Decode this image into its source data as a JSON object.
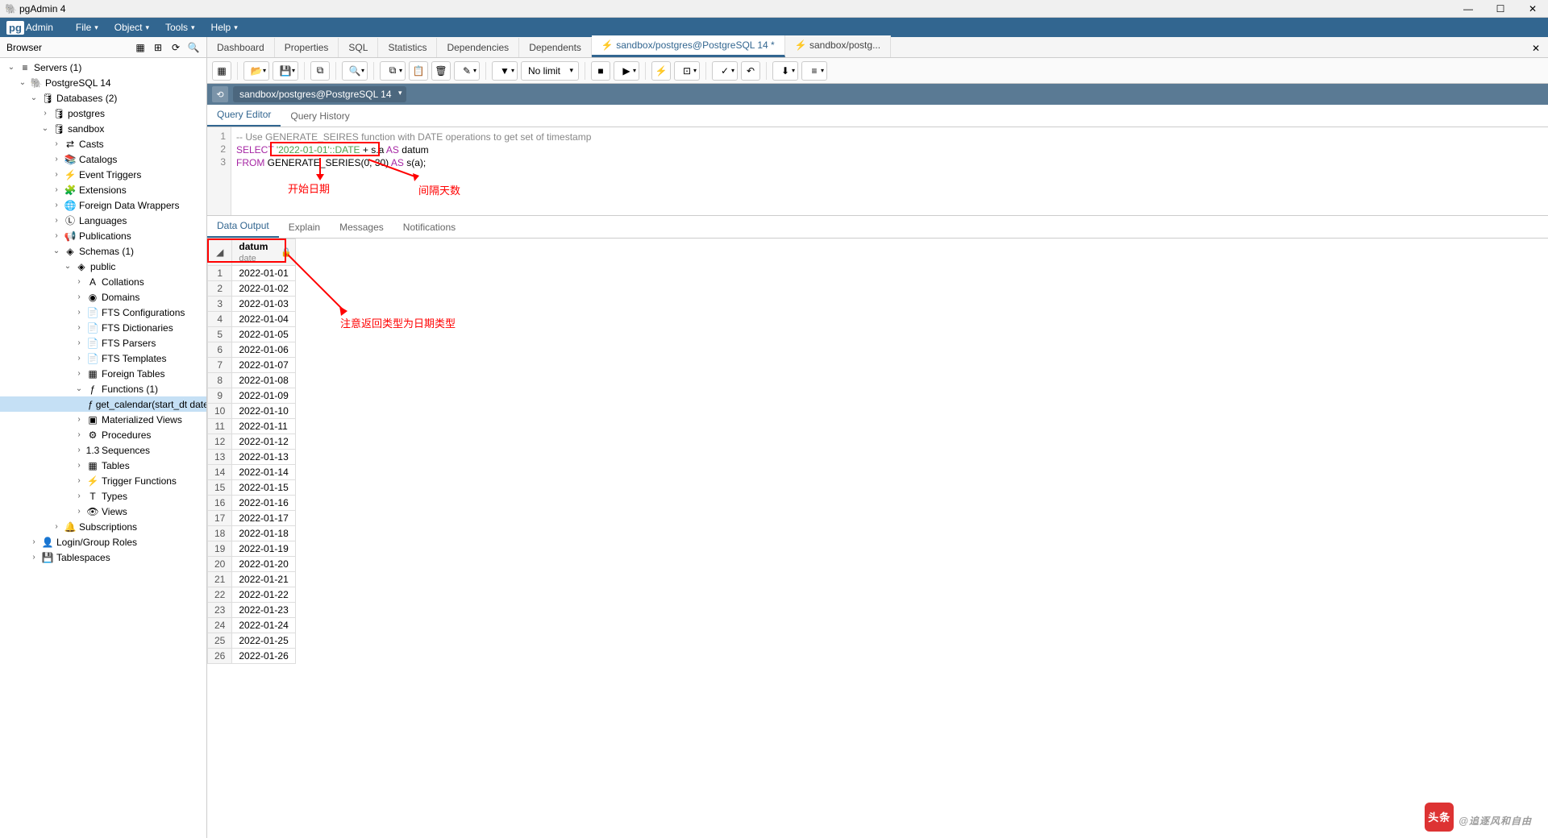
{
  "window": {
    "title": "pgAdmin 4"
  },
  "menubar": {
    "logo": "Admin",
    "items": [
      "File",
      "Object",
      "Tools",
      "Help"
    ]
  },
  "sidebar": {
    "title": "Browser",
    "tree": [
      {
        "i": 0,
        "t": "v",
        "ic": "srv",
        "l": "Servers (1)"
      },
      {
        "i": 1,
        "t": "v",
        "ic": "pg",
        "l": "PostgreSQL 14"
      },
      {
        "i": 2,
        "t": "v",
        "ic": "db",
        "l": "Databases (2)"
      },
      {
        "i": 3,
        "t": ">",
        "ic": "db1",
        "l": "postgres"
      },
      {
        "i": 3,
        "t": "v",
        "ic": "db1",
        "l": "sandbox"
      },
      {
        "i": 4,
        "t": ">",
        "ic": "cast",
        "l": "Casts"
      },
      {
        "i": 4,
        "t": ">",
        "ic": "cat",
        "l": "Catalogs"
      },
      {
        "i": 4,
        "t": ">",
        "ic": "evt",
        "l": "Event Triggers"
      },
      {
        "i": 4,
        "t": ">",
        "ic": "ext",
        "l": "Extensions"
      },
      {
        "i": 4,
        "t": ">",
        "ic": "fdw",
        "l": "Foreign Data Wrappers"
      },
      {
        "i": 4,
        "t": ">",
        "ic": "lang",
        "l": "Languages"
      },
      {
        "i": 4,
        "t": ">",
        "ic": "pub",
        "l": "Publications"
      },
      {
        "i": 4,
        "t": "v",
        "ic": "sch",
        "l": "Schemas (1)"
      },
      {
        "i": 5,
        "t": "v",
        "ic": "pub2",
        "l": "public"
      },
      {
        "i": 6,
        "t": ">",
        "ic": "coll",
        "l": "Collations"
      },
      {
        "i": 6,
        "t": ">",
        "ic": "dom",
        "l": "Domains"
      },
      {
        "i": 6,
        "t": ">",
        "ic": "fts",
        "l": "FTS Configurations"
      },
      {
        "i": 6,
        "t": ">",
        "ic": "fts",
        "l": "FTS Dictionaries"
      },
      {
        "i": 6,
        "t": ">",
        "ic": "fts",
        "l": "FTS Parsers"
      },
      {
        "i": 6,
        "t": ">",
        "ic": "fts",
        "l": "FTS Templates"
      },
      {
        "i": 6,
        "t": ">",
        "ic": "ft",
        "l": "Foreign Tables"
      },
      {
        "i": 6,
        "t": "v",
        "ic": "fn",
        "l": "Functions (1)"
      },
      {
        "i": 7,
        "t": "",
        "ic": "fn1",
        "l": "get_calendar(start_dt date, d...",
        "sel": true
      },
      {
        "i": 6,
        "t": ">",
        "ic": "mv",
        "l": "Materialized Views"
      },
      {
        "i": 6,
        "t": ">",
        "ic": "proc",
        "l": "Procedures"
      },
      {
        "i": 6,
        "t": ">",
        "ic": "seq",
        "l": "Sequences"
      },
      {
        "i": 6,
        "t": ">",
        "ic": "tbl",
        "l": "Tables"
      },
      {
        "i": 6,
        "t": ">",
        "ic": "trg",
        "l": "Trigger Functions"
      },
      {
        "i": 6,
        "t": ">",
        "ic": "typ",
        "l": "Types"
      },
      {
        "i": 6,
        "t": ">",
        "ic": "vw",
        "l": "Views"
      },
      {
        "i": 4,
        "t": ">",
        "ic": "sub",
        "l": "Subscriptions"
      },
      {
        "i": 2,
        "t": ">",
        "ic": "role",
        "l": "Login/Group Roles"
      },
      {
        "i": 2,
        "t": ">",
        "ic": "ts",
        "l": "Tablespaces"
      }
    ]
  },
  "tabs": {
    "items": [
      "Dashboard",
      "Properties",
      "SQL",
      "Statistics",
      "Dependencies",
      "Dependents"
    ],
    "special": [
      {
        "label": "sandbox/postgres@PostgreSQL 14 *",
        "icon": "⚡",
        "active": true
      },
      {
        "label": "sandbox/postg...",
        "icon": "⚡",
        "active": false
      }
    ]
  },
  "toolbar": {
    "nolimit": "No limit"
  },
  "connection": {
    "text": "sandbox/postgres@PostgreSQL 14"
  },
  "editor_tabs": [
    "Query Editor",
    "Query History"
  ],
  "sql": {
    "l1": "-- Use GENERATE_SEIRES function with DATE operations to get set of timestamp",
    "l2_select": "SELECT",
    "l2_str": "'2022-01-01'::DATE",
    "l2_rest1": " + s.a ",
    "l2_as": "AS",
    "l2_rest2": " datum",
    "l3_from": "FROM",
    "l3_fn": " GENERATE_SERIES",
    "l3_args": "(0, 30) ",
    "l3_as": "AS",
    "l3_rest": " s(a);"
  },
  "annotations": {
    "a1": "开始日期",
    "a2": "间隔天数",
    "a3": "注意返回类型为日期类型"
  },
  "result_tabs": [
    "Data Output",
    "Explain",
    "Messages",
    "Notifications"
  ],
  "grid": {
    "col_name": "datum",
    "col_type": "date",
    "rows": [
      "2022-01-01",
      "2022-01-02",
      "2022-01-03",
      "2022-01-04",
      "2022-01-05",
      "2022-01-06",
      "2022-01-07",
      "2022-01-08",
      "2022-01-09",
      "2022-01-10",
      "2022-01-11",
      "2022-01-12",
      "2022-01-13",
      "2022-01-14",
      "2022-01-15",
      "2022-01-16",
      "2022-01-17",
      "2022-01-18",
      "2022-01-19",
      "2022-01-20",
      "2022-01-21",
      "2022-01-22",
      "2022-01-23",
      "2022-01-24",
      "2022-01-25",
      "2022-01-26"
    ]
  },
  "watermark": "@追逐风和自由"
}
